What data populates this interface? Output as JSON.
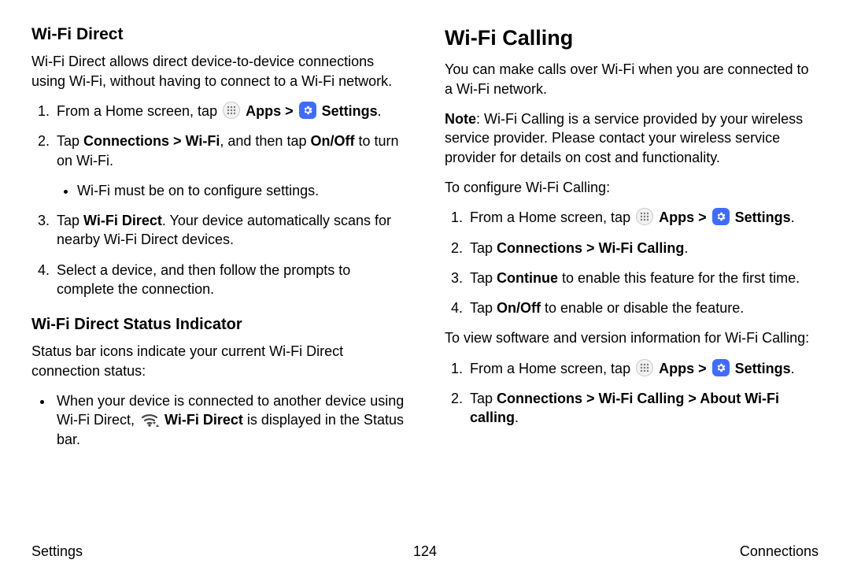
{
  "left": {
    "h2": "Wi-Fi Direct",
    "intro": "Wi-Fi Direct allows direct device-to-device connections using Wi-Fi, without having to connect to a Wi-Fi network.",
    "step1_a": "From a Home screen, tap ",
    "step1_apps": " Apps ",
    "step1_chev": ">",
    "step1_settings": " Settings",
    "step1_end": ".",
    "step2_a": "Tap ",
    "step2_b": "Connections > Wi-Fi",
    "step2_c": ", and then tap ",
    "step2_d": "On/Off",
    "step2_e": " to turn on Wi-Fi.",
    "step2_sub": "Wi-Fi must be on to configure settings.",
    "step3_a": "Tap ",
    "step3_b": "Wi-Fi Direct",
    "step3_c": ". Your device automatically scans for nearby Wi-Fi Direct devices.",
    "step4": "Select a device, and then follow the prompts to complete the connection.",
    "h3": "Wi-Fi Direct Status Indicator",
    "status_intro": "Status bar icons indicate your current Wi-Fi Direct connection status:",
    "status_bullet_a": "When your device is connected to another device using Wi-Fi Direct, ",
    "status_bullet_b": " Wi-Fi Direct",
    "status_bullet_c": " is displayed in the Status bar."
  },
  "right": {
    "h1": "Wi-Fi Calling",
    "intro": "You can make calls over Wi-Fi when you are connected to a Wi-Fi network.",
    "note_a": "Note",
    "note_b": ": Wi-Fi Calling is a service provided by your wireless service provider. Please contact your wireless service provider for details on cost and functionality.",
    "configure": "To configure Wi-Fi Calling:",
    "c_step1_a": "From a Home screen, tap ",
    "c_step1_apps": " Apps ",
    "c_step1_chev": ">",
    "c_step1_settings": " Settings",
    "c_step1_end": ".",
    "c_step2_a": "Tap ",
    "c_step2_b": "Connections > Wi-Fi Calling",
    "c_step2_c": ".",
    "c_step3_a": "Tap ",
    "c_step3_b": "Continue",
    "c_step3_c": " to enable this feature for the first time.",
    "c_step4_a": "Tap ",
    "c_step4_b": "On/Off",
    "c_step4_c": " to enable or disable the feature.",
    "view": "To view software and version information for Wi-Fi Calling:",
    "v_step1_a": "From a Home screen, tap ",
    "v_step1_apps": " Apps ",
    "v_step1_chev": ">",
    "v_step1_settings": " Settings",
    "v_step1_end": ".",
    "v_step2_a": "Tap ",
    "v_step2_b": "Connections > Wi-Fi Calling > About Wi-Fi calling",
    "v_step2_c": "."
  },
  "footer": {
    "left": "Settings",
    "center": "124",
    "right": "Connections"
  }
}
